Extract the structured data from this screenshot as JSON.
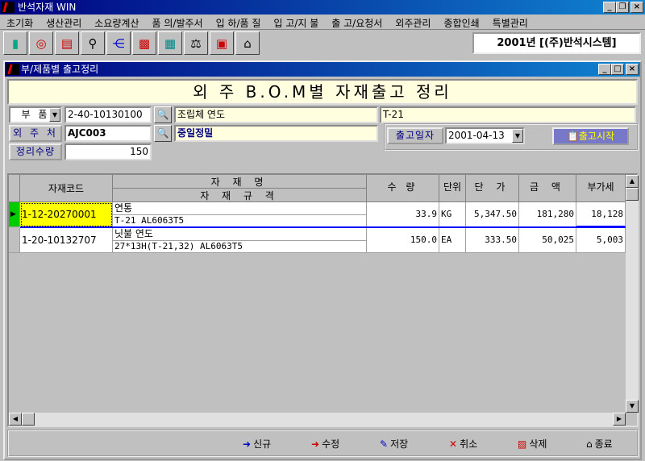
{
  "app": {
    "title": "반석자재 WIN"
  },
  "menu": [
    "초기화",
    "생산관리",
    "소요량계산",
    "품 의/발주서",
    "입 하/품 질",
    "입 고/지 불",
    "출 고/요청서",
    "외주관리",
    "종합인쇄",
    "특별관리"
  ],
  "toolbar": {
    "icons": [
      "exit-icon",
      "refresh-icon",
      "print-icon",
      "search-doc-icon",
      "tree-icon",
      "book-icon",
      "calculator-icon",
      "scale-icon",
      "calendar-icon",
      "home-icon"
    ],
    "company": "2001년 [(주)반석시스템]"
  },
  "child": {
    "title": "부/제품별 출고정리",
    "banner": "외 주 B.O.M별 자재출고 정리",
    "form": {
      "type_select": "부 품",
      "part_code": "2-40-10130100",
      "part_name": "조립체 연도",
      "part_spec": "T-21",
      "vendor_label": "외 주 처",
      "vendor_code": "AJC003",
      "vendor_name": "중일정밀",
      "qty_label": "정리수량",
      "qty": "150",
      "date_label": "출고일자",
      "date": "2001-04-13",
      "start_button": "출고시작"
    },
    "grid": {
      "headers": {
        "code": "자재코드",
        "name": "자 재 명",
        "spec": "자 재 규 격",
        "qty": "수 량",
        "unit": "단위",
        "price": "단 가",
        "amount": "금 액",
        "vat": "부가세"
      },
      "rows": [
        {
          "code": "1-12-20270001",
          "name": "연통",
          "spec": "T-21 AL6063T5",
          "qty": "33.9",
          "unit": "KG",
          "price": "5,347.50",
          "amount": "181,280",
          "vat": "18,128"
        },
        {
          "code": "1-20-10132707",
          "name": "닛불 연도",
          "spec": "27*13H(T-21,32) AL6063T5",
          "qty": "150.0",
          "unit": "EA",
          "price": "333.50",
          "amount": "50,025",
          "vat": "5,003"
        }
      ]
    },
    "buttons": {
      "new": "신규",
      "edit": "수정",
      "save": "저장",
      "cancel": "취소",
      "delete": "삭제",
      "close": "종료"
    }
  }
}
